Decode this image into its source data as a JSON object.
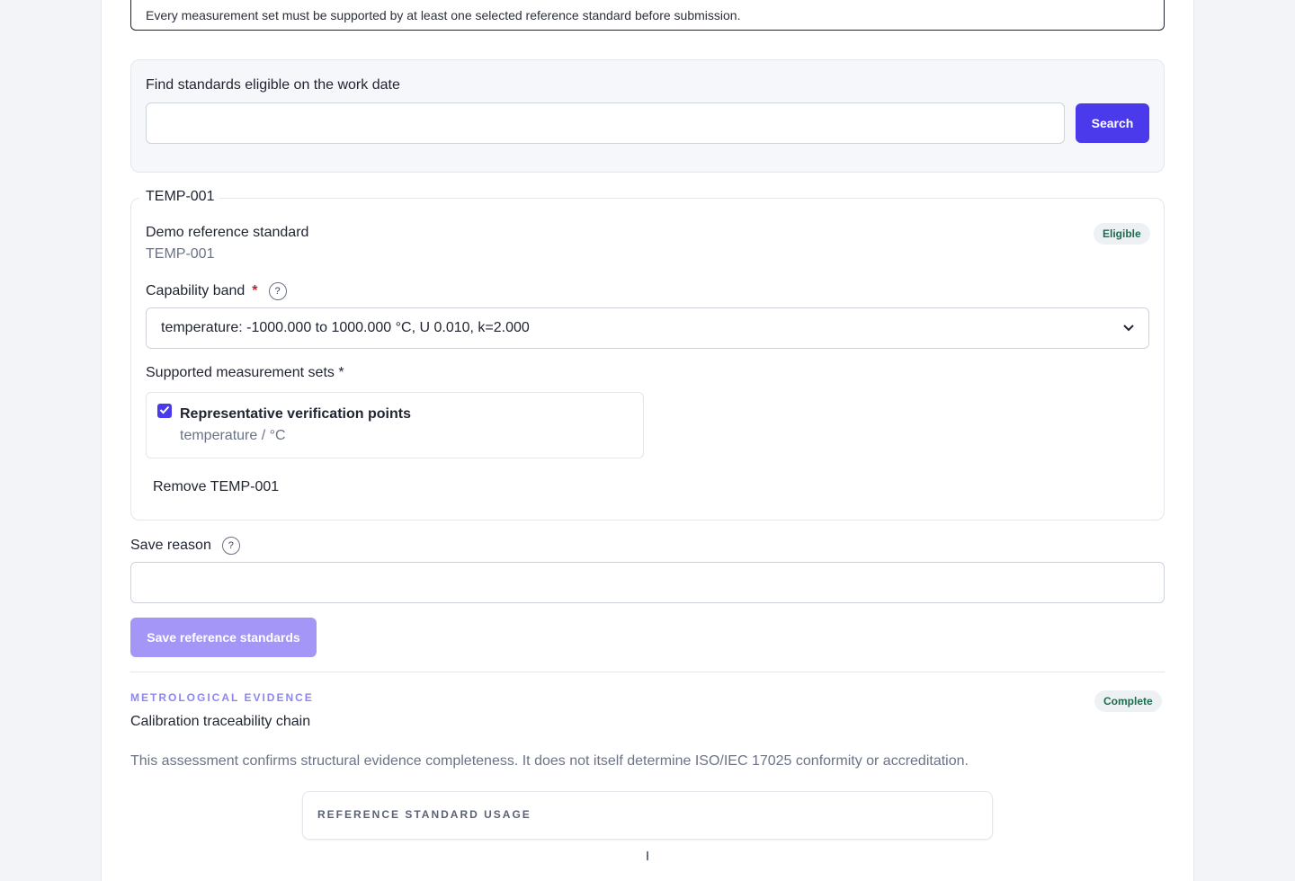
{
  "notice": {
    "text": "Every measurement set must be supported by at least one selected reference standard before submission."
  },
  "search": {
    "label": "Find standards eligible on the work date",
    "value": "",
    "button_label": "Search"
  },
  "standard": {
    "legend": "TEMP-001",
    "name": "Demo reference standard",
    "id": "TEMP-001",
    "status_badge": "Eligible",
    "capability_label": "Capability band",
    "capability_required_mark": "*",
    "help_glyph": "?",
    "capability_selected": "temperature: -1000.000 to 1000.000 °C, U 0.010, k=2.000",
    "measurement_sets_label": "Supported measurement sets *",
    "measurement_set": {
      "checked": true,
      "title": "Representative verification points",
      "subtitle": "temperature / °C"
    },
    "remove_label": "Remove TEMP-001"
  },
  "save_reason": {
    "label": "Save reason",
    "help_glyph": "?",
    "value": ""
  },
  "save_button_label": "Save reference standards",
  "evidence": {
    "eyebrow": "METROLOGICAL EVIDENCE",
    "title": "Calibration traceability chain",
    "status_badge": "Complete",
    "note": "This assessment confirms structural evidence completeness. It does not itself determine ISO/IEC 17025 conformity or accreditation.",
    "usage_card_title": "REFERENCE STANDARD USAGE"
  },
  "colors": {
    "accent": "#4b3aeb",
    "accent_disabled": "#a396f7",
    "success_text": "#1d6b4f",
    "required": "#c81e1e"
  },
  "icons": {
    "checkbox": "checkmark-icon",
    "select": "chevron-down-icon",
    "help": "question-circle-icon"
  }
}
